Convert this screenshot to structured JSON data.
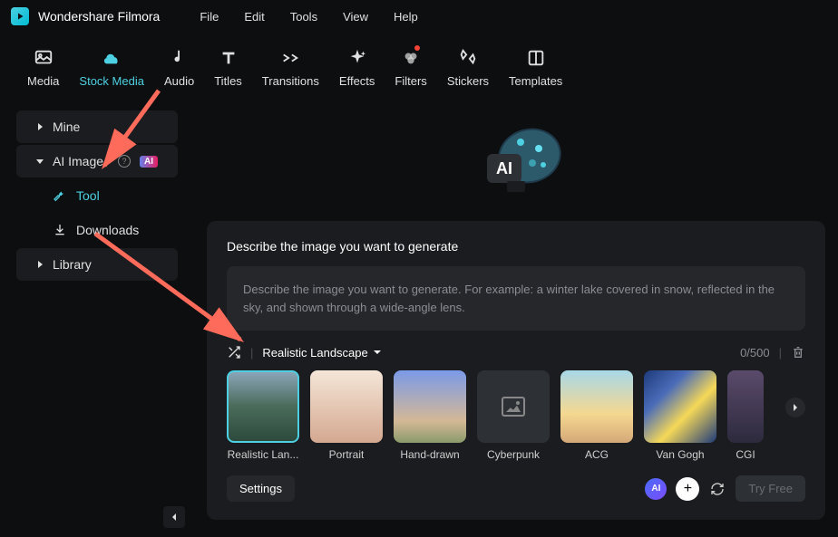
{
  "app": {
    "title": "Wondershare Filmora"
  },
  "menubar": [
    "File",
    "Edit",
    "Tools",
    "View",
    "Help"
  ],
  "nav": [
    {
      "label": "Media",
      "icon": "media"
    },
    {
      "label": "Stock Media",
      "icon": "stock",
      "active": true
    },
    {
      "label": "Audio",
      "icon": "audio"
    },
    {
      "label": "Titles",
      "icon": "titles"
    },
    {
      "label": "Transitions",
      "icon": "transitions"
    },
    {
      "label": "Effects",
      "icon": "effects"
    },
    {
      "label": "Filters",
      "icon": "filters",
      "dot": true
    },
    {
      "label": "Stickers",
      "icon": "stickers"
    },
    {
      "label": "Templates",
      "icon": "templates"
    }
  ],
  "sidebar": {
    "mine": "Mine",
    "ai_image": "AI Image",
    "ai_badge": "AI",
    "tool": "Tool",
    "downloads": "Downloads",
    "library": "Library"
  },
  "panel": {
    "title": "Describe the image you want to generate",
    "placeholder": "Describe the image you want to generate. For example: a winter lake covered in snow, reflected in the sky, and shown through a wide-angle lens.",
    "style_label": "Realistic Landscape",
    "char_count": "0/500",
    "styles": [
      {
        "label": "Realistic Lan...",
        "selected": true,
        "thumb": "landscape"
      },
      {
        "label": "Portrait",
        "thumb": "portrait"
      },
      {
        "label": "Hand-drawn",
        "thumb": "hand"
      },
      {
        "label": "Cyberpunk",
        "thumb": "cyber"
      },
      {
        "label": "ACG",
        "thumb": "acg"
      },
      {
        "label": "Van Gogh",
        "thumb": "vang"
      },
      {
        "label": "CGI",
        "thumb": "cgi"
      }
    ],
    "settings_label": "Settings",
    "try_label": "Try Free",
    "ai_round": "AI"
  }
}
